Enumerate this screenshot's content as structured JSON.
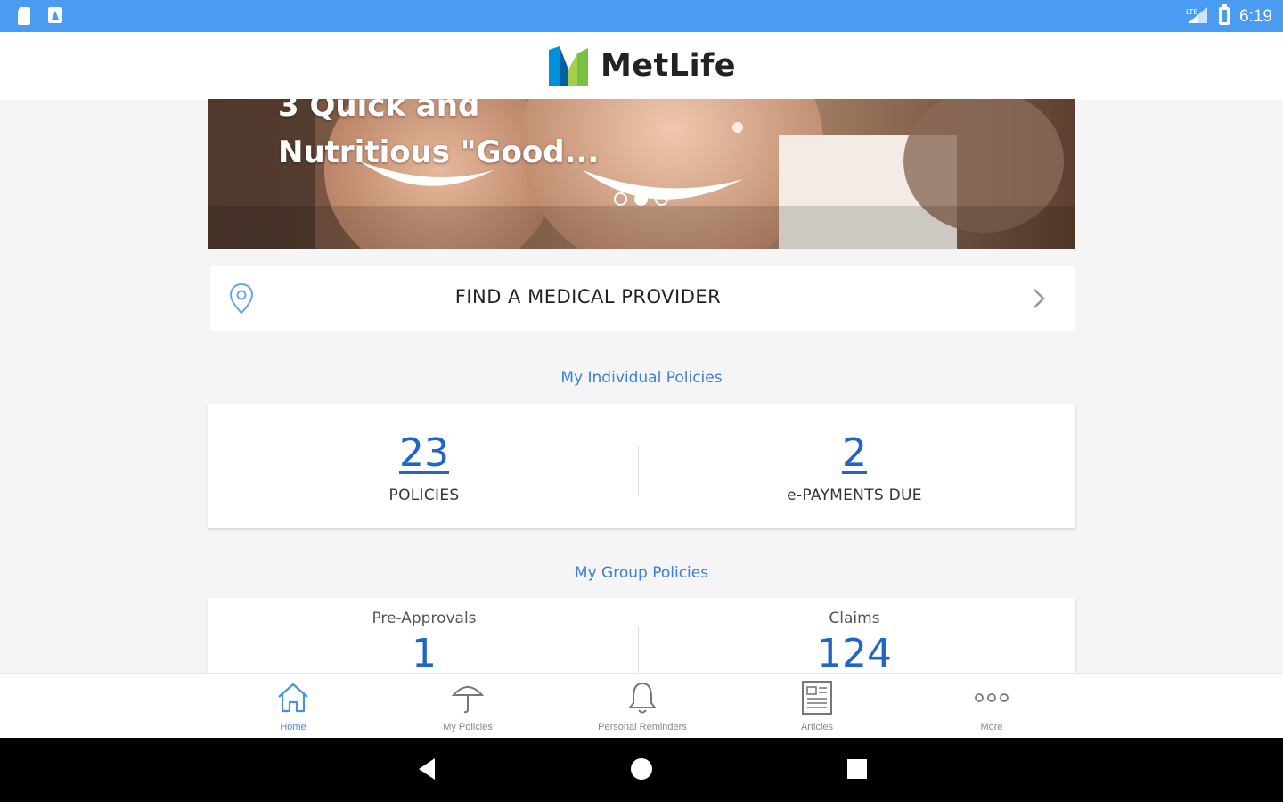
{
  "status_bar": {
    "time": "6:19"
  },
  "header": {
    "brand": "MetLife"
  },
  "hero": {
    "headline_line1": "3 Quick and",
    "headline_line2": "Nutritious \"Good...",
    "carousel_active_index": 1,
    "carousel_count": 3
  },
  "finder": {
    "label": "FIND A MEDICAL PROVIDER"
  },
  "individual": {
    "title": "My Individual Policies",
    "policies_count": "23",
    "policies_label": "POLICIES",
    "payments_count": "2",
    "payments_label": "e-PAYMENTS DUE"
  },
  "group": {
    "title": "My Group Policies",
    "preapprovals_label": "Pre-Approvals",
    "preapprovals_count": "1",
    "claims_label": "Claims",
    "claims_count": "124"
  },
  "bottom_nav": {
    "items": [
      {
        "label": "Home",
        "icon": "home-icon",
        "active": true
      },
      {
        "label": "My Policies",
        "icon": "umbrella-icon",
        "active": false
      },
      {
        "label": "Personal Reminders",
        "icon": "bell-icon",
        "active": false
      },
      {
        "label": "Articles",
        "icon": "article-icon",
        "active": false
      },
      {
        "label": "More",
        "icon": "more-icon",
        "active": false
      }
    ]
  },
  "colors": {
    "status_bar": "#4a9bf2",
    "accent_blue": "#1f66c6",
    "section_blue": "#3b7fd4",
    "brand_green": "#7ac143",
    "brand_blue": "#0090da"
  }
}
